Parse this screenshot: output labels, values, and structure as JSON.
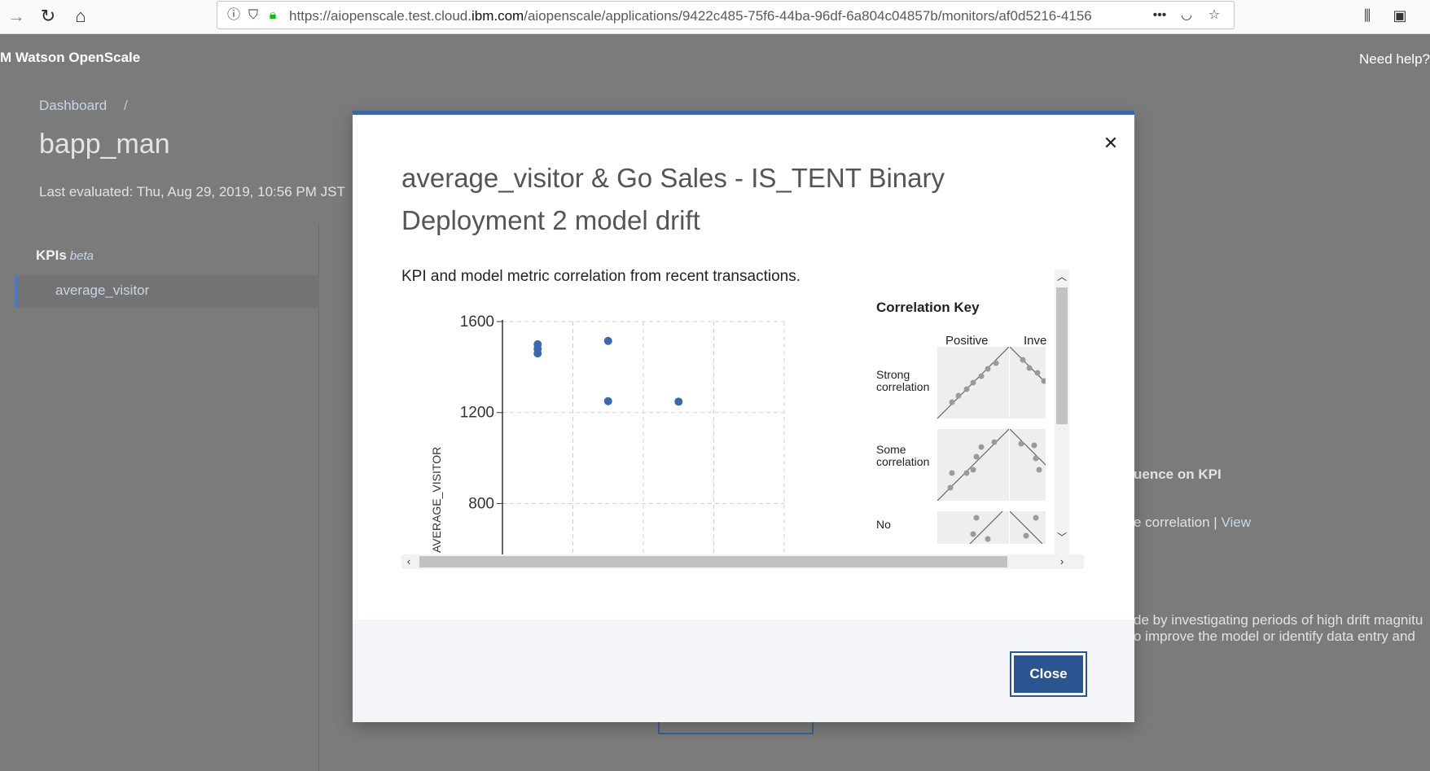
{
  "browser": {
    "url_prefix": "https://aiopenscale.test.cloud.",
    "url_domain": "ibm.com",
    "url_suffix": "/aiopenscale/applications/9422c485-75f6-44ba-96df-6a804c04857b/monitors/af0d5216-4156"
  },
  "app": {
    "title": "M Watson OpenScale",
    "need_help": "Need help?"
  },
  "page": {
    "breadcrumb": "Dashboard",
    "breadcrumb_sep": "/",
    "title": "bapp_man",
    "last_evaluated": "Last evaluated: Thu, Aug 29, 2019, 10:56 PM JST",
    "kpis_label": "KPIs",
    "kpis_beta": "beta",
    "kpi_item": "average_visitor",
    "influence_heading": "uence on KPI",
    "correlation_text": "e correlation |",
    "view_link": "View",
    "guide_line1": "de by investigating periods of high drift magnitu",
    "guide_line2": "o improve the model or identify data entry and"
  },
  "modal": {
    "title": "average_visitor & Go Sales - IS_TENT Binary Deployment 2 model drift",
    "subtitle": "KPI and model metric correlation from recent transactions.",
    "close_label": "Close",
    "key": {
      "title": "Correlation Key",
      "col_positive": "Positive",
      "col_inverse": "Inve",
      "row_strong_1": "Strong",
      "row_strong_2": "correlation",
      "row_some_1": "Some",
      "row_some_2": "correlation",
      "row_no": "No"
    }
  },
  "chart_data": {
    "type": "scatter",
    "ylabel": "AVERAGE_VISITOR",
    "y_ticks": [
      1600,
      1200,
      800
    ],
    "y_tick_labels": [
      "1600",
      "1200",
      "800"
    ],
    "ylim": [
      576,
      1600
    ],
    "point_color": "#3d67a8",
    "points": [
      {
        "col": 1,
        "y": 1500
      },
      {
        "col": 1,
        "y": 1480
      },
      {
        "col": 1,
        "y": 1460
      },
      {
        "col": 2,
        "y": 1515
      },
      {
        "col": 2,
        "y": 1250
      },
      {
        "col": 3,
        "y": 1248
      }
    ]
  }
}
